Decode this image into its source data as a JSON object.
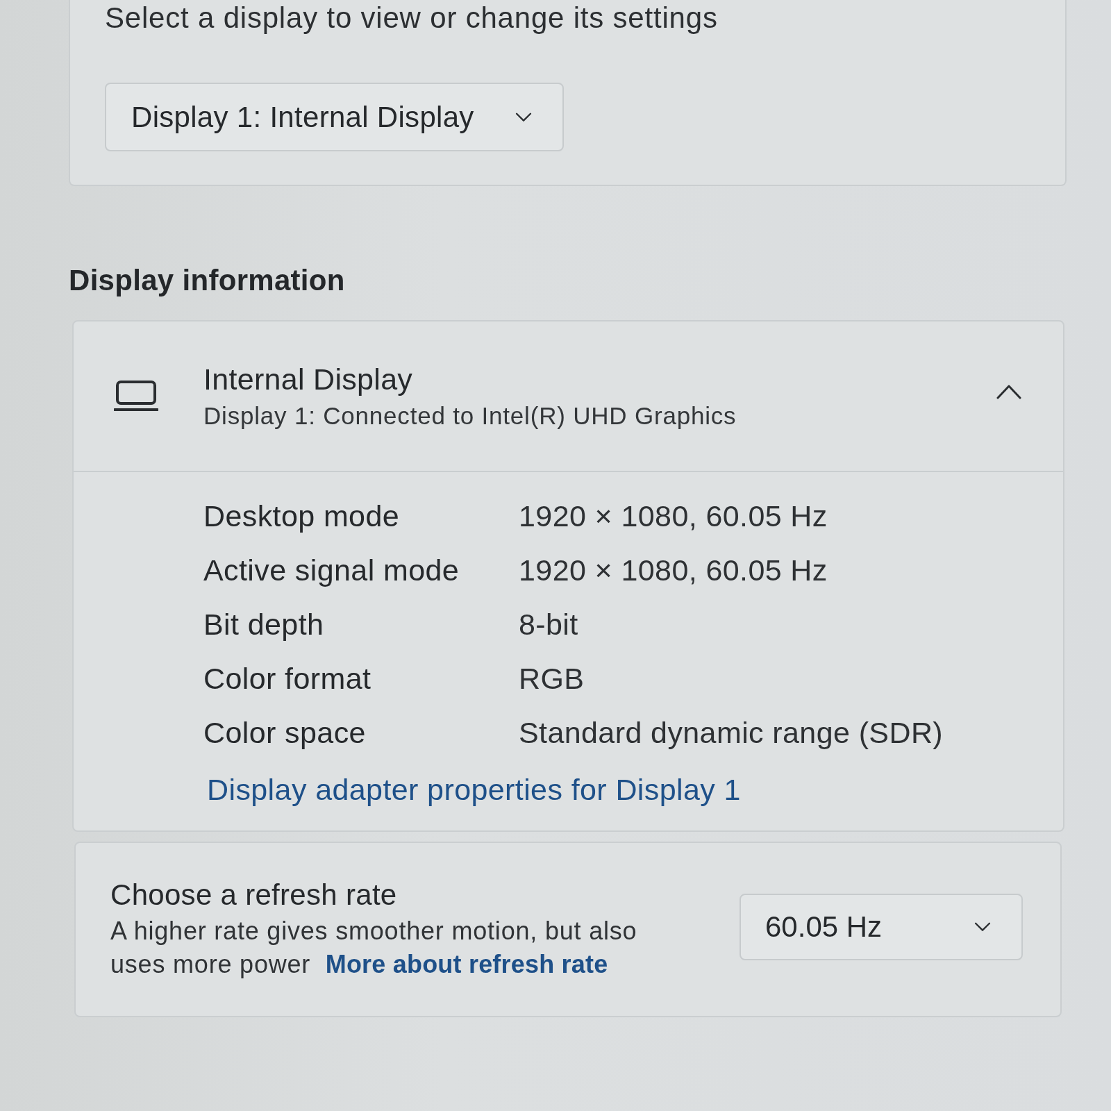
{
  "display_select": {
    "label": "Select a display to view or change its settings",
    "dropdown": {
      "value": "Display 1: Internal Display"
    }
  },
  "section_heading": "Display information",
  "display_info": {
    "title": "Internal Display",
    "subtitle": "Display 1: Connected to Intel(R) UHD Graphics",
    "expanded": true,
    "rows": [
      {
        "label": "Desktop mode",
        "value": "1920 × 1080, 60.05 Hz"
      },
      {
        "label": "Active signal mode",
        "value": "1920 × 1080, 60.05 Hz"
      },
      {
        "label": "Bit depth",
        "value": "8-bit"
      },
      {
        "label": "Color format",
        "value": "RGB"
      },
      {
        "label": "Color space",
        "value": "Standard dynamic range (SDR)"
      }
    ],
    "link": "Display adapter properties for Display 1"
  },
  "refresh_rate": {
    "title": "Choose a refresh rate",
    "description": "A higher rate gives smoother motion, but also uses more power",
    "link": "More about refresh rate",
    "dropdown": {
      "value": "60.05 Hz"
    }
  }
}
